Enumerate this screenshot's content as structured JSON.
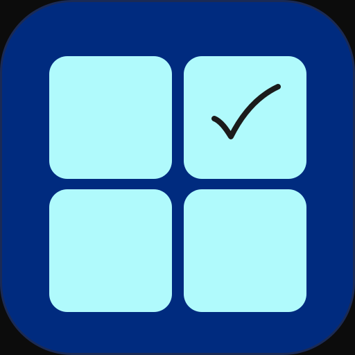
{
  "icon": {
    "name": "checklist-grid-app-icon",
    "background_color": "#002b7f",
    "tile_color": "#b0fafc",
    "check_color": "#1b1b1b",
    "tiles": [
      {
        "position": "top-left",
        "checked": false
      },
      {
        "position": "top-right",
        "checked": true
      },
      {
        "position": "bottom-left",
        "checked": false
      },
      {
        "position": "bottom-right",
        "checked": false
      }
    ],
    "check_icon": "checkmark-icon"
  }
}
